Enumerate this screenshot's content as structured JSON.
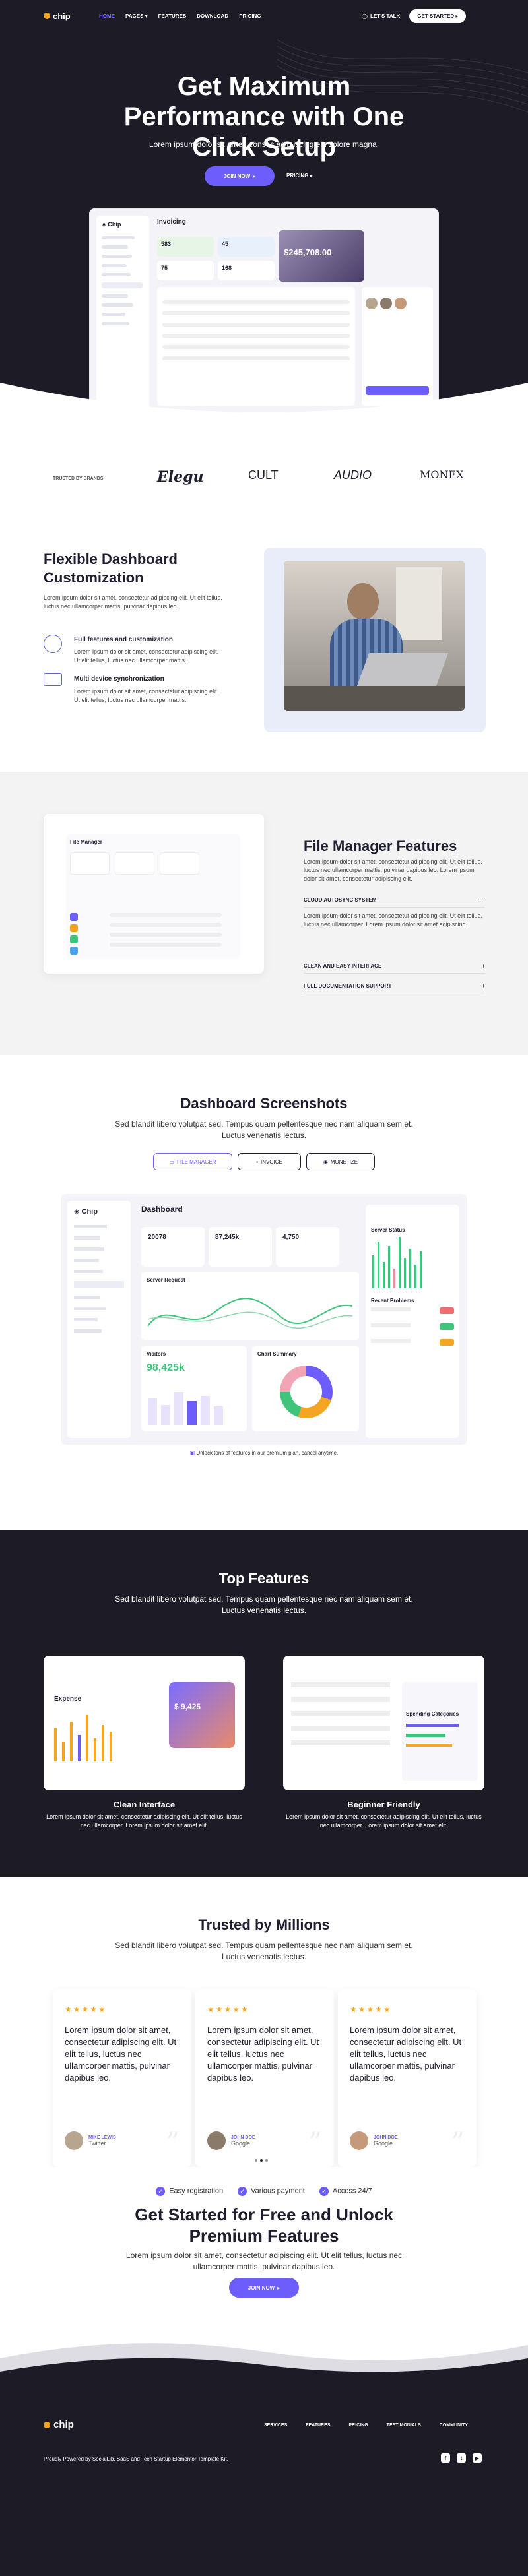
{
  "nav": {
    "logo": "chip",
    "items": [
      "HOME",
      "PAGES",
      "FEATURES",
      "DOWNLOAD",
      "PRICING"
    ],
    "talk": "LET'S TALK",
    "cta": "GET STARTED"
  },
  "hero": {
    "title": "Get Maximum Performance with One Click Setup",
    "subtitle": "Lorem ipsum dolor sit amet, consec adip iscing elit dolore magna.",
    "join": "JOIN NOW",
    "pricing": "PRICING",
    "dash_title": "Invoicing",
    "dash_balance": "$245,708.00",
    "stats": [
      "583",
      "45",
      "75",
      "168"
    ]
  },
  "brands": {
    "label": "TRUSTED BY BRANDS",
    "items": [
      "Elegu",
      "CULT",
      "AUDIO",
      "MONEX"
    ]
  },
  "flexible": {
    "title": "Flexible Dashboard Customization",
    "text": "Lorem ipsum dolor sit amet, consectetur adipiscing elit. Ut elit tellus, luctus nec ullamcorper mattis, pulvinar dapibus leo.",
    "f1_title": "Full features and customization",
    "f1_text": "Lorem ipsum dolor sit amet, consectetur adipiscing elit. Ut elit tellus, luctus nec ullamcorper mattis.",
    "f2_title": "Multi device synchronization",
    "f2_text": "Lorem ipsum dolor sit amet, consectetur adipiscing elit. Ut elit tellus, luctus nec ullamcorper mattis."
  },
  "filemanager": {
    "title": "File Manager Features",
    "text": "Lorem ipsum dolor sit amet, consectetur adipiscing elit. Ut elit tellus, luctus nec ullamcorper mattis, pulvinar dapibus leo. Lorem ipsum dolor sit amet, consectetur adipiscing elit.",
    "acc1": "CLOUD AUTOSYNC SYSTEM",
    "acc1_text": "Lorem ipsum dolor sit amet, consectetur adipiscing elit. Ut elit tellus, luctus nec ullamcorper. Lorem ipsum dolor sit amet adipiscing.",
    "acc2": "CLEAN AND EASY INTERFACE",
    "acc3": "FULL DOCUMENTATION SUPPORT",
    "panel_title": "File Manager"
  },
  "screenshots": {
    "title": "Dashboard Screenshots",
    "subtitle": "Sed blandit libero volutpat sed. Tempus quam pellentesque nec nam aliquam sem et. Luctus venenatis lectus.",
    "tabs": [
      "FILE MANAGER",
      "INVOICE",
      "MONETIZE"
    ],
    "dash_title": "Dashboard",
    "stats": [
      "20078",
      "87,245k",
      "4,750"
    ],
    "server": "Server Request",
    "visitors": "Visitors",
    "visitors_val": "98,425k",
    "chart_summary": "Chart Summary",
    "server_status": "Server Status",
    "recent": "Recent Problems",
    "unlock": "Unlock tons of features in our premium plan, cancel anytime."
  },
  "topfeatures": {
    "title": "Top Features",
    "subtitle": "Sed blandit libero volutpat sed. Tempus quam pellentesque nec nam aliquam sem et. Luctus venenatis lectus.",
    "c1_title": "Clean Interface",
    "c1_text": "Lorem ipsum dolor sit amet, consectetur adipiscing elit. Ut elit tellus, luctus nec ullamcorper. Lorem ipsum dolor sit amet elit.",
    "c2_title": "Beginner Friendly",
    "c2_text": "Lorem ipsum dolor sit amet, consectetur adipiscing elit. Ut elit tellus, luctus nec ullamcorper. Lorem ipsum dolor sit amet elit.",
    "expense": "Expense",
    "expense_amount": "$ 9,425",
    "spending": "Spending Categories"
  },
  "trusted": {
    "title": "Trusted by Millions",
    "subtitle": "Sed blandit libero volutpat sed. Tempus quam pellentesque nec nam aliquam sem et. Luctus venenatis lectus.",
    "quote": "Lorem ipsum dolor sit amet, consectetur adipiscing elit. Ut elit tellus, luctus nec ullamcorper mattis, pulvinar dapibus leo.",
    "stars": "★★★★★",
    "people": [
      {
        "name": "MIKE LEWIS",
        "company": "Twitter"
      },
      {
        "name": "JOHN DOE",
        "company": "Google"
      },
      {
        "name": "JOHN DOE",
        "company": "Google"
      }
    ]
  },
  "cta": {
    "pills": [
      "Easy registration",
      "Various payment",
      "Access 24/7"
    ],
    "title": "Get Started for Free and Unlock Premium Features",
    "subtitle": "Lorem ipsum dolor sit amet, consectetur adipiscing elit. Ut elit tellus, luctus nec ullamcorper mattis, pulvinar dapibus leo.",
    "join": "JOIN NOW"
  },
  "footer": {
    "logo": "chip",
    "links": [
      "SERVICES",
      "FEATURES",
      "PRICING",
      "TESTIMONIALS",
      "COMMUNITY"
    ],
    "copyright": "Proudly Powered by SocialLib. SaaS and Tech Startup Elementor Template Kit."
  },
  "colors": {
    "accent": "#6d5dfc",
    "dark": "#1d1c26",
    "star": "#f5a524"
  }
}
